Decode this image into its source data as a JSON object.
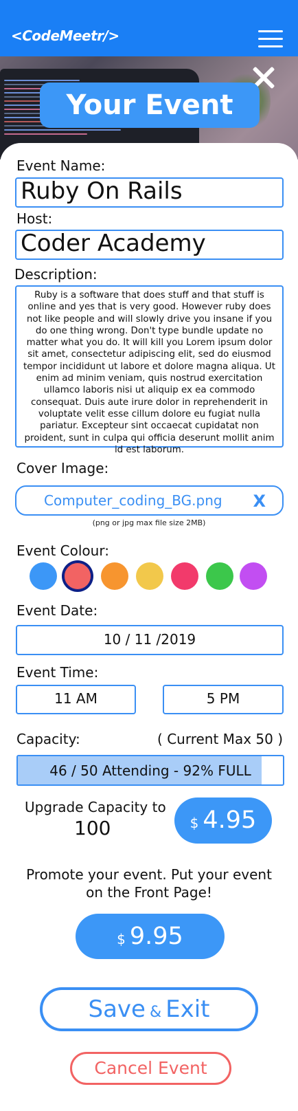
{
  "header": {
    "logo": "<CodeMeetr/>",
    "menu_icon": "hamburger-menu-icon",
    "close_icon": "close-icon"
  },
  "page": {
    "title": "Your Event"
  },
  "form": {
    "event_name": {
      "label": "Event Name:",
      "value": "Ruby On Rails"
    },
    "host": {
      "label": "Host:",
      "value": "Coder Academy"
    },
    "description": {
      "label": "Description:",
      "value": "Ruby is a software that does stuff and that stuff is online and yes that is very good. However ruby does not like people and will slowly drive you insane if you do one thing wrong. Don't type bundle update no matter what you do. It will kill you Lorem ipsum dolor sit amet, consectetur adipiscing elit, sed do eiusmod tempor incididunt ut labore et dolore magna aliqua. Ut enim ad minim veniam, quis nostrud exercitation ullamco laboris nisi ut aliquip ex ea commodo consequat. Duis aute irure dolor in reprehenderit in voluptate velit esse cillum dolore eu fugiat nulla pariatur. Excepteur sint occaecat cupidatat non proident, sunt in culpa qui officia deserunt mollit anim id est laborum."
    },
    "cover_image": {
      "label": "Cover Image:",
      "file_name": "Computer_coding_BG.png",
      "remove": "X",
      "hint": "(png or jpg max file size 2MB)"
    },
    "event_colour": {
      "label": "Event Colour:",
      "selected_index": 1,
      "colours": [
        "#3c97f7",
        "#f26363",
        "#f7952f",
        "#f2c84b",
        "#f23a6b",
        "#3cc74b",
        "#c24ef2"
      ]
    },
    "event_date": {
      "label": "Event Date:",
      "value": "10 / 11 /2019"
    },
    "event_time": {
      "label": "Event Time:",
      "start": "11 AM",
      "end": "5 PM"
    },
    "capacity": {
      "label": "Capacity:",
      "current_max": "( Current Max 50 )",
      "status": "46 / 50 Attending - 92% FULL",
      "fill_fraction": 0.92
    },
    "upgrade": {
      "label": "Upgrade Capacity to",
      "value": "100",
      "currency": "$",
      "price": "4.95"
    },
    "promote": {
      "text": "Promote your event. Put your event on the Front Page!",
      "currency": "$",
      "price": "9.95"
    }
  },
  "actions": {
    "save_part1": "Save",
    "save_amp": "&",
    "save_part2": "Exit",
    "cancel": "Cancel Event"
  }
}
